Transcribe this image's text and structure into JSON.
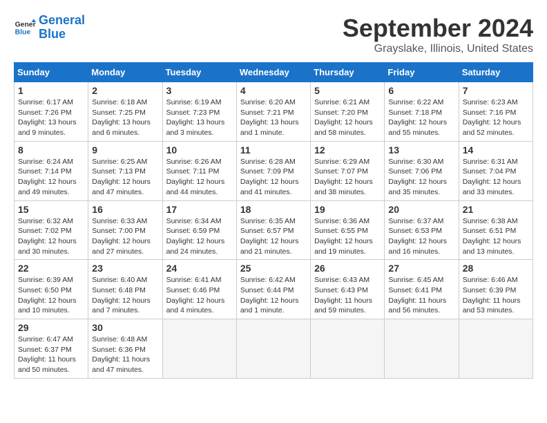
{
  "header": {
    "logo_line1": "General",
    "logo_line2": "Blue",
    "title": "September 2024",
    "subtitle": "Grayslake, Illinois, United States"
  },
  "calendar": {
    "days_of_week": [
      "Sunday",
      "Monday",
      "Tuesday",
      "Wednesday",
      "Thursday",
      "Friday",
      "Saturday"
    ],
    "weeks": [
      [
        {
          "day": "1",
          "info": "Sunrise: 6:17 AM\nSunset: 7:26 PM\nDaylight: 13 hours\nand 9 minutes."
        },
        {
          "day": "2",
          "info": "Sunrise: 6:18 AM\nSunset: 7:25 PM\nDaylight: 13 hours\nand 6 minutes."
        },
        {
          "day": "3",
          "info": "Sunrise: 6:19 AM\nSunset: 7:23 PM\nDaylight: 13 hours\nand 3 minutes."
        },
        {
          "day": "4",
          "info": "Sunrise: 6:20 AM\nSunset: 7:21 PM\nDaylight: 13 hours\nand 1 minute."
        },
        {
          "day": "5",
          "info": "Sunrise: 6:21 AM\nSunset: 7:20 PM\nDaylight: 12 hours\nand 58 minutes."
        },
        {
          "day": "6",
          "info": "Sunrise: 6:22 AM\nSunset: 7:18 PM\nDaylight: 12 hours\nand 55 minutes."
        },
        {
          "day": "7",
          "info": "Sunrise: 6:23 AM\nSunset: 7:16 PM\nDaylight: 12 hours\nand 52 minutes."
        }
      ],
      [
        {
          "day": "8",
          "info": "Sunrise: 6:24 AM\nSunset: 7:14 PM\nDaylight: 12 hours\nand 49 minutes."
        },
        {
          "day": "9",
          "info": "Sunrise: 6:25 AM\nSunset: 7:13 PM\nDaylight: 12 hours\nand 47 minutes."
        },
        {
          "day": "10",
          "info": "Sunrise: 6:26 AM\nSunset: 7:11 PM\nDaylight: 12 hours\nand 44 minutes."
        },
        {
          "day": "11",
          "info": "Sunrise: 6:28 AM\nSunset: 7:09 PM\nDaylight: 12 hours\nand 41 minutes."
        },
        {
          "day": "12",
          "info": "Sunrise: 6:29 AM\nSunset: 7:07 PM\nDaylight: 12 hours\nand 38 minutes."
        },
        {
          "day": "13",
          "info": "Sunrise: 6:30 AM\nSunset: 7:06 PM\nDaylight: 12 hours\nand 35 minutes."
        },
        {
          "day": "14",
          "info": "Sunrise: 6:31 AM\nSunset: 7:04 PM\nDaylight: 12 hours\nand 33 minutes."
        }
      ],
      [
        {
          "day": "15",
          "info": "Sunrise: 6:32 AM\nSunset: 7:02 PM\nDaylight: 12 hours\nand 30 minutes."
        },
        {
          "day": "16",
          "info": "Sunrise: 6:33 AM\nSunset: 7:00 PM\nDaylight: 12 hours\nand 27 minutes."
        },
        {
          "day": "17",
          "info": "Sunrise: 6:34 AM\nSunset: 6:59 PM\nDaylight: 12 hours\nand 24 minutes."
        },
        {
          "day": "18",
          "info": "Sunrise: 6:35 AM\nSunset: 6:57 PM\nDaylight: 12 hours\nand 21 minutes."
        },
        {
          "day": "19",
          "info": "Sunrise: 6:36 AM\nSunset: 6:55 PM\nDaylight: 12 hours\nand 19 minutes."
        },
        {
          "day": "20",
          "info": "Sunrise: 6:37 AM\nSunset: 6:53 PM\nDaylight: 12 hours\nand 16 minutes."
        },
        {
          "day": "21",
          "info": "Sunrise: 6:38 AM\nSunset: 6:51 PM\nDaylight: 12 hours\nand 13 minutes."
        }
      ],
      [
        {
          "day": "22",
          "info": "Sunrise: 6:39 AM\nSunset: 6:50 PM\nDaylight: 12 hours\nand 10 minutes."
        },
        {
          "day": "23",
          "info": "Sunrise: 6:40 AM\nSunset: 6:48 PM\nDaylight: 12 hours\nand 7 minutes."
        },
        {
          "day": "24",
          "info": "Sunrise: 6:41 AM\nSunset: 6:46 PM\nDaylight: 12 hours\nand 4 minutes."
        },
        {
          "day": "25",
          "info": "Sunrise: 6:42 AM\nSunset: 6:44 PM\nDaylight: 12 hours\nand 1 minute."
        },
        {
          "day": "26",
          "info": "Sunrise: 6:43 AM\nSunset: 6:43 PM\nDaylight: 11 hours\nand 59 minutes."
        },
        {
          "day": "27",
          "info": "Sunrise: 6:45 AM\nSunset: 6:41 PM\nDaylight: 11 hours\nand 56 minutes."
        },
        {
          "day": "28",
          "info": "Sunrise: 6:46 AM\nSunset: 6:39 PM\nDaylight: 11 hours\nand 53 minutes."
        }
      ],
      [
        {
          "day": "29",
          "info": "Sunrise: 6:47 AM\nSunset: 6:37 PM\nDaylight: 11 hours\nand 50 minutes."
        },
        {
          "day": "30",
          "info": "Sunrise: 6:48 AM\nSunset: 6:36 PM\nDaylight: 11 hours\nand 47 minutes."
        },
        {
          "day": "",
          "info": ""
        },
        {
          "day": "",
          "info": ""
        },
        {
          "day": "",
          "info": ""
        },
        {
          "day": "",
          "info": ""
        },
        {
          "day": "",
          "info": ""
        }
      ]
    ]
  }
}
